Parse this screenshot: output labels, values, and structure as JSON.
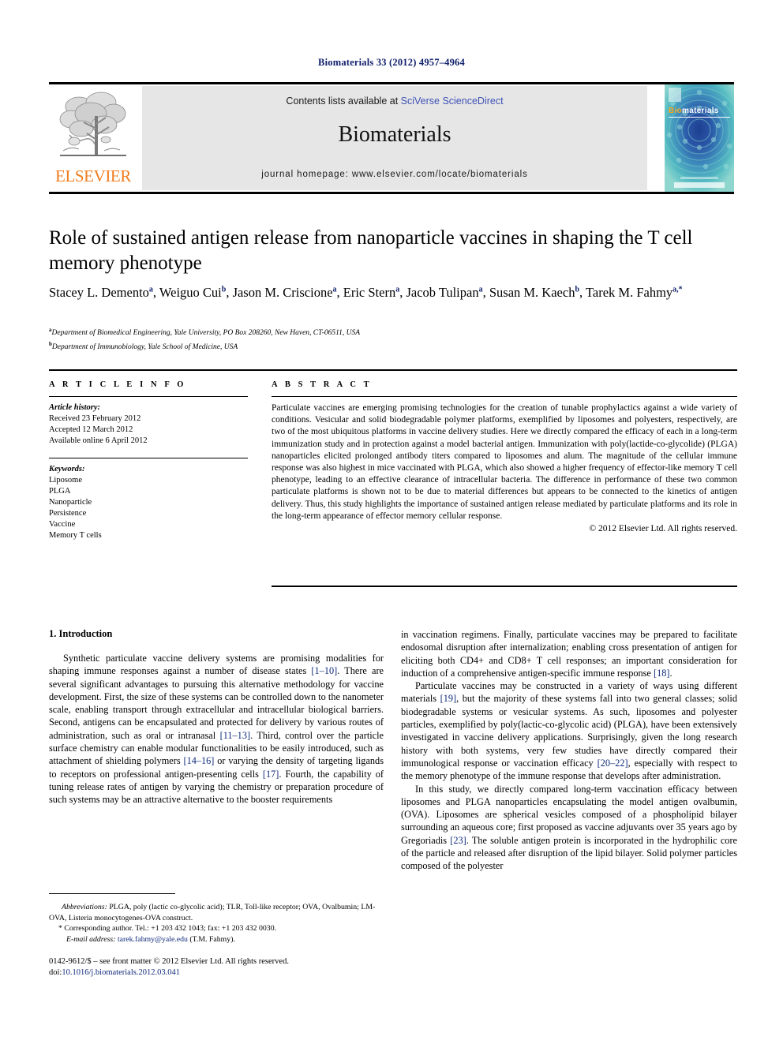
{
  "running_head": "Biomaterials 33 (2012) 4957–4964",
  "masthead": {
    "publisher_wordmark": "ELSEVIER",
    "contents_prefix": "Contents lists available at ",
    "contents_link": "SciVerse ScienceDirect",
    "journal_name": "Biomaterials",
    "homepage_line": "journal homepage: www.elsevier.com/locate/biomaterials",
    "cover": {
      "title_part1": "Bio",
      "title_part2": "materials"
    },
    "colors": {
      "elsevier_orange": "#f07c1e",
      "link_blue": "#3f51b5",
      "masthead_grey": "#e6e6e6",
      "cover_teal": "#3fb8bf"
    }
  },
  "article": {
    "title": "Role of sustained antigen release from nanoparticle vaccines in shaping the T cell memory phenotype",
    "authors": [
      {
        "name": "Stacey L. Demento",
        "sup": "a"
      },
      {
        "name": "Weiguo Cui",
        "sup": "b"
      },
      {
        "name": "Jason M. Criscione",
        "sup": "a"
      },
      {
        "name": "Eric Stern",
        "sup": "a"
      },
      {
        "name": "Jacob Tulipan",
        "sup": "a"
      },
      {
        "name": "Susan M. Kaech",
        "sup": "b"
      },
      {
        "name": "Tarek M. Fahmy",
        "sup": "a,*"
      }
    ],
    "affiliations": [
      {
        "marker": "a",
        "text": "Department of Biomedical Engineering, Yale University, PO Box 208260, New Haven, CT-06511, USA"
      },
      {
        "marker": "b",
        "text": "Department of Immunobiology, Yale School of Medicine, USA"
      }
    ]
  },
  "article_info": {
    "heading": "A R T I C L E   I N F O",
    "history_label": "Article history:",
    "history": [
      "Received 23 February 2012",
      "Accepted 12 March 2012",
      "Available online 6 April 2012"
    ],
    "keywords_label": "Keywords:",
    "keywords": [
      "Liposome",
      "PLGA",
      "Nanoparticle",
      "Persistence",
      "Vaccine",
      "Memory T cells"
    ]
  },
  "abstract": {
    "heading": "A B S T R A C T",
    "text": "Particulate vaccines are emerging promising technologies for the creation of tunable prophylactics against a wide variety of conditions. Vesicular and solid biodegradable polymer platforms, exemplified by liposomes and polyesters, respectively, are two of the most ubiquitous platforms in vaccine delivery studies. Here we directly compared the efficacy of each in a long-term immunization study and in protection against a model bacterial antigen. Immunization with poly(lactide-co-glycolide) (PLGA) nanoparticles elicited prolonged antibody titers compared to liposomes and alum. The magnitude of the cellular immune response was also highest in mice vaccinated with PLGA, which also showed a higher frequency of effector-like memory T cell phenotype, leading to an effective clearance of intracellular bacteria. The difference in performance of these two common particulate platforms is shown not to be due to material differences but appears to be connected to the kinetics of antigen delivery. Thus, this study highlights the importance of sustained antigen release mediated by particulate platforms and its role in the long-term appearance of effector memory cellular response.",
    "copyright": "© 2012 Elsevier Ltd. All rights reserved."
  },
  "body": {
    "section_heading": "1. Introduction",
    "left_paragraphs": [
      "Synthetic particulate vaccine delivery systems are promising modalities for shaping immune responses against a number of disease states [1–10]. There are several significant advantages to pursuing this alternative methodology for vaccine development. First, the size of these systems can be controlled down to the nanometer scale, enabling transport through extracellular and intracellular biological barriers. Second, antigens can be encapsulated and protected for delivery by various routes of administration, such as oral or intranasal [11–13]. Third, control over the particle surface chemistry can enable modular functionalities to be easily introduced, such as attachment of shielding polymers [14–16] or varying the density of targeting ligands to receptors on professional antigen-presenting cells [17]. Fourth, the capability of tuning release rates of antigen by varying the chemistry or preparation procedure of such systems may be an attractive alternative to the booster requirements"
    ],
    "right_paragraphs": [
      "in vaccination regimens. Finally, particulate vaccines may be prepared to facilitate endosomal disruption after internalization; enabling cross presentation of antigen for eliciting both CD4+ and CD8+ T cell responses; an important consideration for induction of a comprehensive antigen-specific immune response [18].",
      "Particulate vaccines may be constructed in a variety of ways using different materials [19], but the majority of these systems fall into two general classes; solid biodegradable systems or vesicular systems. As such, liposomes and polyester particles, exemplified by poly(lactic-co-glycolic acid) (PLGA), have been extensively investigated in vaccine delivery applications. Surprisingly, given the long research history with both systems, very few studies have directly compared their immunological response or vaccination efficacy [20–22], especially with respect to the memory phenotype of the immune response that develops after administration.",
      "In this study, we directly compared long-term vaccination efficacy between liposomes and PLGA nanoparticles encapsulating the model antigen ovalbumin, (OVA). Liposomes are spherical vesicles composed of a phospholipid bilayer surrounding an aqueous core; first proposed as vaccine adjuvants over 35 years ago by Gregoriadis [23]. The soluble antigen protein is incorporated in the hydrophilic core of the particle and released after disruption of the lipid bilayer. Solid polymer particles composed of the polyester"
    ]
  },
  "footnotes": {
    "abbreviations_label": "Abbreviations:",
    "abbreviations_text": "PLGA, poly (lactic co-glycolic acid); TLR, Toll-like receptor; OVA, Ovalbumin; LM-OVA, Listeria monocytogenes-OVA construct.",
    "corresponding": "* Corresponding author. Tel.: +1 203 432 1043; fax: +1 203 432 0030.",
    "email_label": "E-mail address:",
    "email": "tarek.fahmy@yale.edu",
    "email_suffix": " (T.M. Fahmy)."
  },
  "issn_block": {
    "line1": "0142-9612/$ – see front matter © 2012 Elsevier Ltd. All rights reserved.",
    "doi_label": "doi:",
    "doi": "10.1016/j.biomaterials.2012.03.041"
  }
}
